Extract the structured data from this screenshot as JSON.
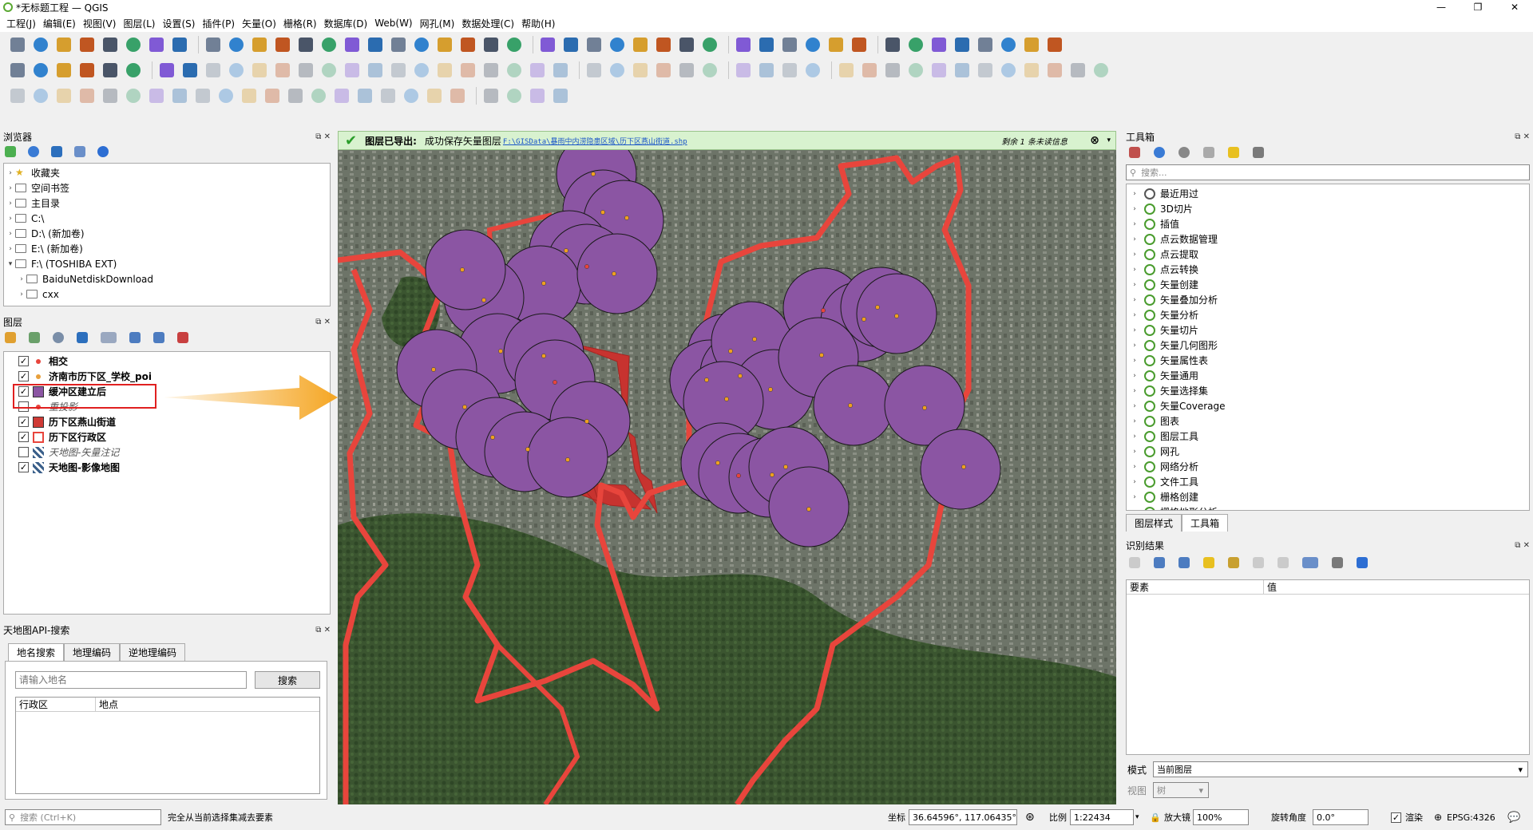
{
  "window": {
    "title": "*无标题工程 — QGIS"
  },
  "menu": [
    "工程(J)",
    "编辑(E)",
    "视图(V)",
    "图层(L)",
    "设置(S)",
    "插件(P)",
    "矢量(O)",
    "栅格(R)",
    "数据库(D)",
    "Web(W)",
    "网孔(M)",
    "数据处理(C)",
    "帮助(H)"
  ],
  "browser": {
    "title": "浏览器",
    "items": [
      {
        "label": "收藏夹",
        "icon": "star-icon"
      },
      {
        "label": "空间书签",
        "icon": "bookmark-icon"
      },
      {
        "label": "主目录",
        "icon": "folder-icon"
      },
      {
        "label": "C:\\",
        "icon": "drive-icon"
      },
      {
        "label": "D:\\ (新加卷)",
        "icon": "drive-icon"
      },
      {
        "label": "E:\\ (新加卷)",
        "icon": "drive-icon"
      },
      {
        "label": "F:\\ (TOSHIBA EXT)",
        "icon": "drive-icon"
      },
      {
        "label": "BaiduNetdiskDownload",
        "icon": "folder-icon"
      },
      {
        "label": "cxx",
        "icon": "folder-icon"
      }
    ]
  },
  "layers": {
    "title": "图层",
    "items": [
      {
        "label": "相交",
        "checked": true,
        "symbol": "point",
        "color": "#e8453c"
      },
      {
        "label": "济南市历下区_学校_poi",
        "checked": true,
        "symbol": "point",
        "color": "#e8a03c"
      },
      {
        "label": "缓冲区建立后",
        "checked": true,
        "symbol": "fill",
        "color": "#8b55a3"
      },
      {
        "label": "重投影",
        "checked": false,
        "symbol": "point",
        "color": "#e8453c"
      },
      {
        "label": "历下区燕山街道",
        "checked": true,
        "symbol": "fill",
        "color": "#cf3a35"
      },
      {
        "label": "历下区行政区",
        "checked": true,
        "symbol": "outline",
        "color": "#e8453c"
      },
      {
        "label": "天地图-矢量注记",
        "checked": false,
        "symbol": "tile",
        "color": "#3a5f8a"
      },
      {
        "label": "天地图-影像地图",
        "checked": true,
        "symbol": "tile",
        "color": "#3a5f8a"
      }
    ]
  },
  "search_panel": {
    "title": "天地图API-搜索",
    "tabs": [
      "地名搜索",
      "地理编码",
      "逆地理编码"
    ],
    "placeholder": "请输入地名",
    "button": "搜索",
    "columns": [
      "行政区",
      "地点"
    ]
  },
  "message": {
    "title": "图层已导出:",
    "text": "成功保存矢量图层",
    "link": "F:\\GISData\\暴雨中内涝隐患区域\\历下区燕山街道.shp",
    "remaining": "剩余 1 条未读信息"
  },
  "toolbox": {
    "title": "工具箱",
    "placeholder": "搜索...",
    "items": [
      "最近用过",
      "3D切片",
      "插值",
      "点云数据管理",
      "点云提取",
      "点云转换",
      "矢量创建",
      "矢量叠加分析",
      "矢量分析",
      "矢量切片",
      "矢量几何图形",
      "矢量属性表",
      "矢量通用",
      "矢量选择集",
      "矢量Coverage",
      "图表",
      "图层工具",
      "网孔",
      "网络分析",
      "文件工具",
      "栅格创建",
      "栅格地形分析"
    ],
    "tabs": [
      "图层样式",
      "工具箱"
    ]
  },
  "identify": {
    "title": "识别结果",
    "columns": [
      "要素",
      "值"
    ],
    "mode_label": "模式",
    "mode_value": "当前图层",
    "view_label": "视图",
    "view_value": "树"
  },
  "status": {
    "search_placeholder": "搜索 (Ctrl+K)",
    "message": "完全从当前选择集减去要素",
    "coord_label": "坐标",
    "coord_value": "36.64596°, 117.06435°",
    "scale_label": "比例",
    "scale_value": "1:22434",
    "magnifier_label": "放大镜",
    "magnifier_value": "100%",
    "rotation_label": "旋转角度",
    "rotation_value": "0.0°",
    "render_label": "渲染",
    "crs": "EPSG:4326"
  },
  "colors": {
    "accent": "#3a7bd5",
    "buffer": "#8b55a3",
    "boundary": "#e8453c",
    "highlight": "#e02020",
    "arrow": "#f5a623"
  }
}
